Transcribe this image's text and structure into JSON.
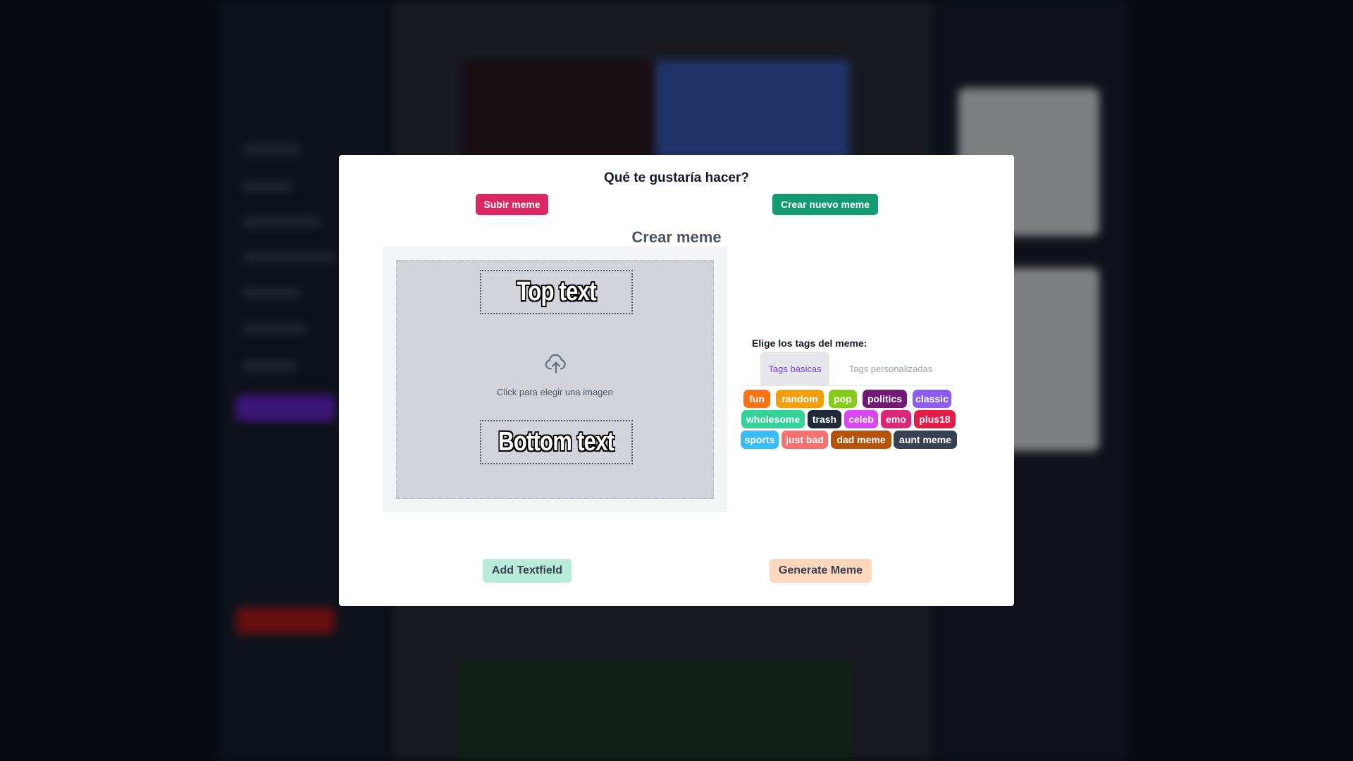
{
  "modal": {
    "title": "Qué te gustaría hacer?",
    "upload_button": "Subir meme",
    "create_button": "Crear nuevo meme",
    "section_title": "Crear meme"
  },
  "editor": {
    "top_text": "Top text",
    "bottom_text": "Bottom text",
    "upload_hint": "Click para elegir una imagen",
    "upload_icon": "cloud-upload-icon"
  },
  "tags": {
    "title": "Elige los tags del meme:",
    "tabs": [
      "Tags básicas",
      "Tags personalizadas"
    ],
    "active_tab": "Tags básicas",
    "items": [
      {
        "label": "fun",
        "color": "#f97316"
      },
      {
        "label": "random",
        "color": "#f59e0b"
      },
      {
        "label": "pop",
        "color": "#84cc16"
      },
      {
        "label": "politics",
        "color": "#701a75"
      },
      {
        "label": "classic",
        "color": "#8b5cf6"
      },
      {
        "label": "wholesome",
        "color": "#34d399"
      },
      {
        "label": "trash",
        "color": "#1f2937"
      },
      {
        "label": "celeb",
        "color": "#d946ef"
      },
      {
        "label": "emo",
        "color": "#db2777"
      },
      {
        "label": "plus18",
        "color": "#e11d48"
      },
      {
        "label": "sports",
        "color": "#38bdf8"
      },
      {
        "label": "just bad",
        "color": "#f87171"
      },
      {
        "label": "dad meme",
        "color": "#b45309"
      },
      {
        "label": "aunt meme",
        "color": "#374151"
      }
    ]
  },
  "actions": {
    "add_textfield": "Add Textfield",
    "generate": "Generate Meme"
  },
  "colors": {
    "upload_button": "#db2763",
    "create_button": "#129b70",
    "add_textfield": "#b9ebd9",
    "generate": "#fed8bc"
  }
}
